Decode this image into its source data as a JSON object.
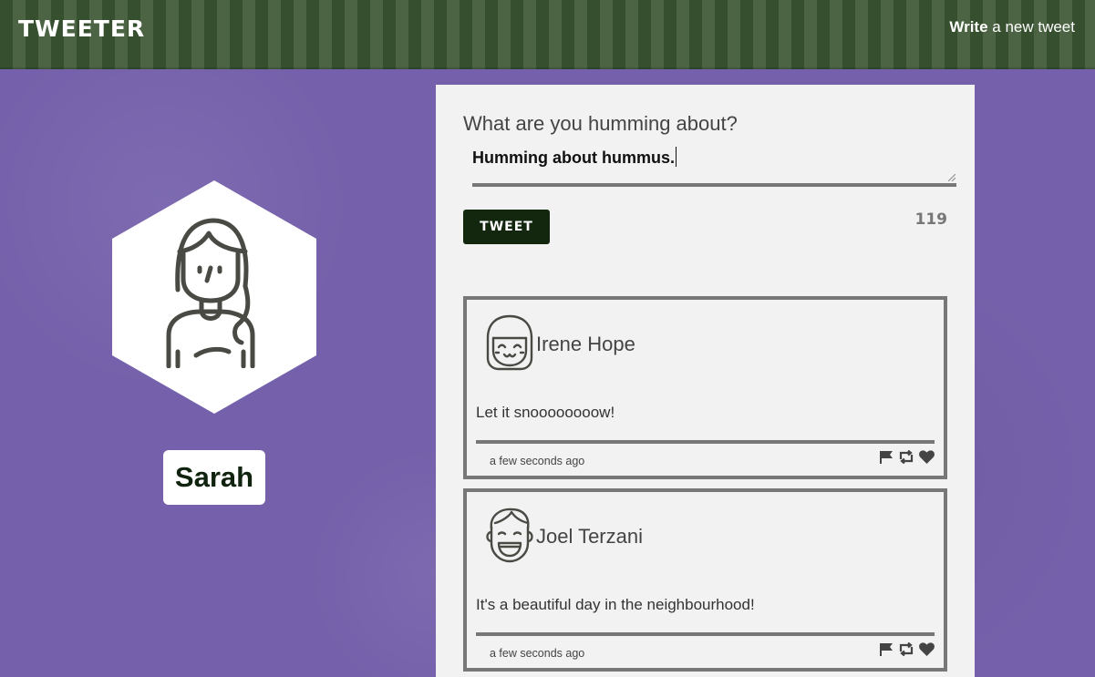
{
  "nav": {
    "brand": "TWEETER",
    "compose_bold": "Write",
    "compose_rest": " a new tweet"
  },
  "profile": {
    "username": "Sarah",
    "avatar_icon": "woman-avatar-icon"
  },
  "composer": {
    "prompt": "What are you humming about?",
    "input_value": "Humming about hummus.",
    "submit_label": "TWEET",
    "counter": "119"
  },
  "tweets": [
    {
      "name": "Irene Hope",
      "avatar_icon": "girl-avatar-icon",
      "body": "Let it snoooooooow!",
      "time": "a few seconds ago"
    },
    {
      "name": "Joel Terzani",
      "avatar_icon": "boy-avatar-icon",
      "body": "It's a beautiful day in the neighbourhood!",
      "time": "a few seconds ago"
    }
  ],
  "icons": {
    "flag": "flag-icon",
    "retweet": "retweet-icon",
    "like": "heart-icon"
  },
  "colors": {
    "background": "#7561ab",
    "nav": "#3f5637",
    "button": "#13270f",
    "panel": "#f2f2f2",
    "border": "#777777"
  }
}
